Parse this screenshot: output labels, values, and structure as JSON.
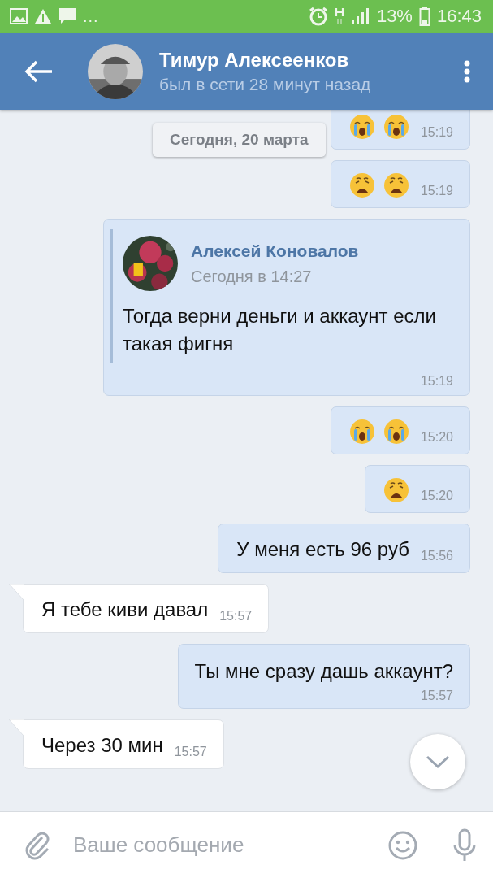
{
  "status_bar": {
    "more": "...",
    "battery": "13%",
    "time": "16:43"
  },
  "header": {
    "name": "Тимур Алексеенков",
    "status": "был в сети 28 минут назад"
  },
  "date_label": "Сегодня, 20 марта",
  "messages": [
    {
      "incoming": false,
      "kind": "emoji",
      "emojis": [
        {
          "kind": "crying"
        },
        {
          "kind": "crying"
        }
      ],
      "time": "15:19"
    },
    {
      "incoming": false,
      "kind": "emoji",
      "emojis": [
        {
          "kind": "weary"
        },
        {
          "kind": "weary"
        }
      ],
      "time": "15:19"
    },
    {
      "incoming": false,
      "kind": "forward",
      "author": "Алексей Коновалов",
      "subtitle": "Сегодня в 14:27",
      "text": "Тогда верни деньги и аккаунт если такая фигня",
      "time": "15:19"
    },
    {
      "incoming": false,
      "kind": "emoji",
      "emojis": [
        {
          "kind": "crying"
        },
        {
          "kind": "crying"
        }
      ],
      "time": "15:20"
    },
    {
      "incoming": false,
      "kind": "emoji",
      "emojis": [
        {
          "kind": "weary"
        }
      ],
      "time": "15:20"
    },
    {
      "incoming": false,
      "kind": "text",
      "text": "У меня есть 96 руб",
      "time": "15:56"
    },
    {
      "incoming": true,
      "kind": "text",
      "text": "Я тебе киви давал",
      "time": "15:57"
    },
    {
      "incoming": false,
      "kind": "text",
      "text": "Ты мне сразу дашь аккаунт?",
      "time": "15:57",
      "stacked": true
    },
    {
      "incoming": true,
      "kind": "text",
      "text": "Через 30 мин",
      "time": "15:57"
    }
  ],
  "composer": {
    "placeholder": "Ваше сообщение"
  }
}
